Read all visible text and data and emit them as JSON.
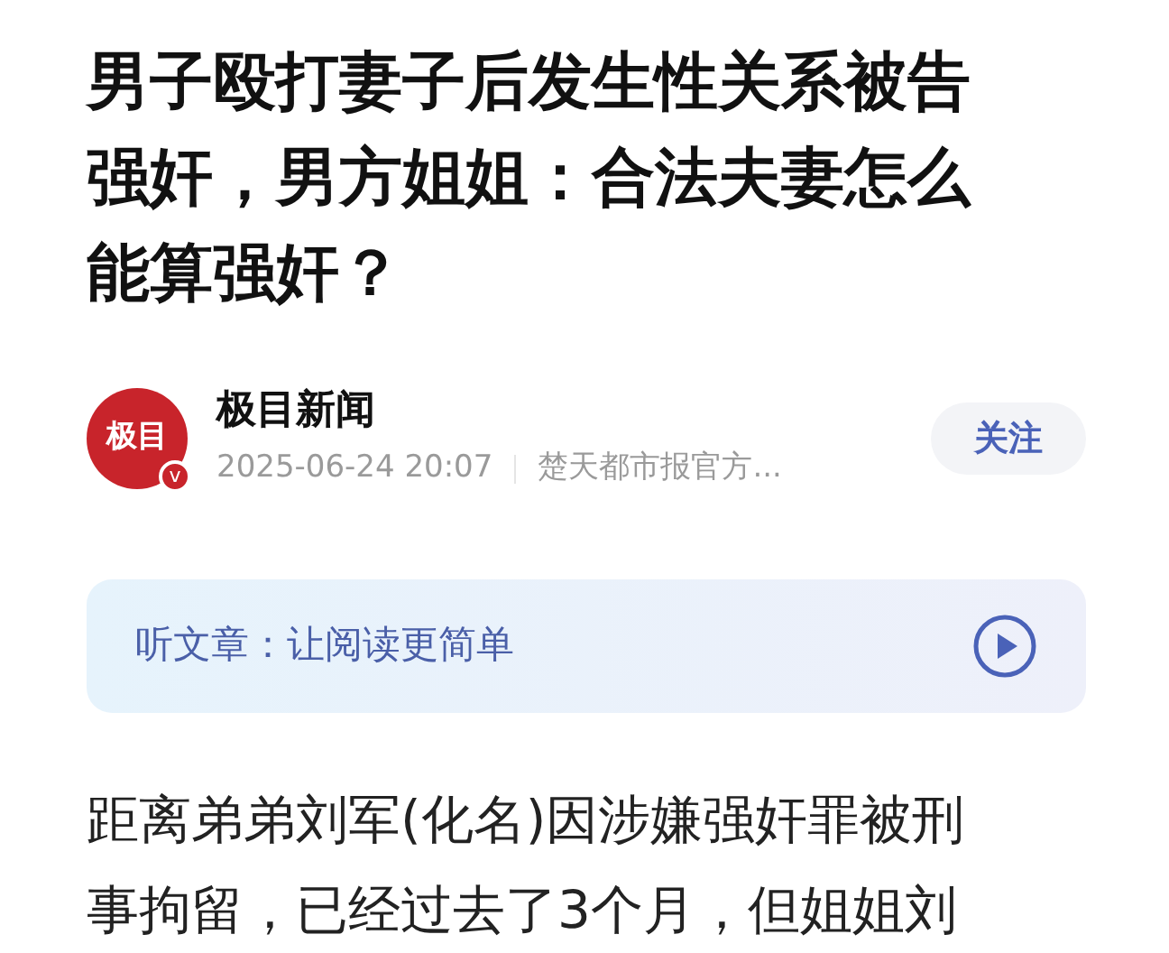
{
  "article": {
    "title": "男子殴打妻子后发生性关系被告强奸，男方姐姐：合法夫妻怎么能算强奸？"
  },
  "author": {
    "logo_text": "极目",
    "verified_badge": "v",
    "name": "极目新闻",
    "time": "2025-06-24 20:07",
    "source": "楚天都市报官方...",
    "follow_label": "关注"
  },
  "listen": {
    "label": "听文章：让阅读更简单"
  },
  "body": {
    "lines": [
      "距离弟弟刘军(化名)因涉嫌强奸罪被刑",
      "事拘留，已经过去了3个月，但姐姐刘"
    ]
  }
}
